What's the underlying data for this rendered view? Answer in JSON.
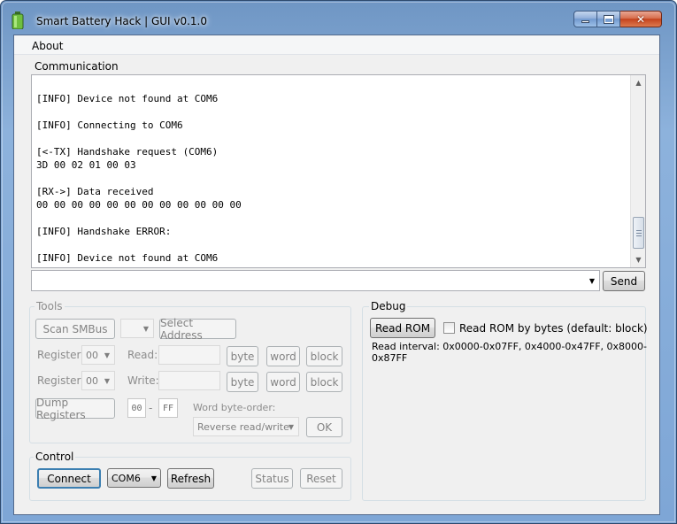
{
  "window": {
    "title": "Smart Battery Hack  |  GUI v0.1.0",
    "min_label": "",
    "max_label": "",
    "close_label": "✕"
  },
  "menu": {
    "about": "About"
  },
  "communication": {
    "label": "Communication",
    "log_lines": [
      "",
      "[INFO] Device not found at COM6",
      "",
      "[INFO] Connecting to COM6",
      "",
      "[<-TX] Handshake request (COM6)",
      "3D 00 02 01 00 03",
      "",
      "[RX->] Data received",
      "00 00 00 00 00 00 00 00 00 00 00 00",
      "",
      "[INFO] Handshake ERROR:",
      "",
      "[INFO] Device not found at COM6"
    ],
    "input_value": "",
    "send_label": "Send"
  },
  "tools": {
    "label": "Tools",
    "scan_label": "Scan SMBus",
    "address_value": "",
    "select_address_label": "Select Address",
    "register_label": "Register:",
    "register_read_value": "00",
    "read_label": "Read:",
    "read_value": "",
    "register_write_value": "00",
    "write_label": "Write:",
    "write_value": "",
    "byte_label": "byte",
    "word_label": "word",
    "block_label": "block",
    "dump_label": "Dump Registers",
    "dump_start": "00",
    "dump_dash": "-",
    "dump_end": "FF",
    "byte_order_label": "Word byte-order:",
    "byte_order_value": "Reverse read/write",
    "ok_label": "OK"
  },
  "control": {
    "label": "Control",
    "connect_label": "Connect",
    "port_value": "COM6",
    "refresh_label": "Refresh",
    "status_label": "Status",
    "reset_label": "Reset"
  },
  "debug": {
    "label": "Debug",
    "read_rom_label": "Read ROM",
    "checkbox_label": "Read ROM by bytes (default: block)",
    "checkbox_checked": false,
    "interval_text": "Read interval: 0x0000-0x07FF, 0x4000-0x47FF, 0x8000-0x87FF"
  }
}
